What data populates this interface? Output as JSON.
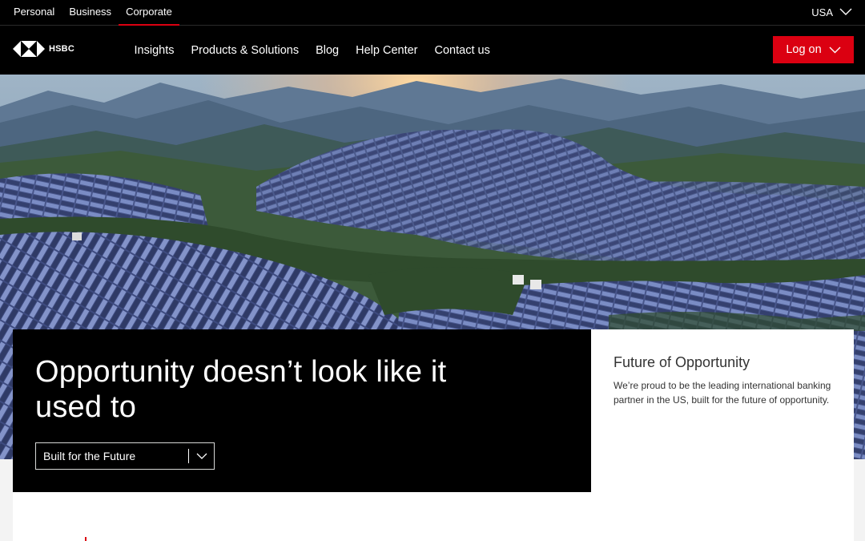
{
  "top_bar": {
    "segments": [
      "Personal",
      "Business",
      "Corporate"
    ],
    "active_segment": "Corporate",
    "country": "USA"
  },
  "nav": {
    "brand": "HSBC",
    "links": [
      "Insights",
      "Products & Solutions",
      "Blog",
      "Help Center",
      "Contact us"
    ],
    "logon_label": "Log on"
  },
  "hero": {
    "image": "aerial-solar-panel-hillsides-at-sunrise",
    "headline": "Opportunity doesn’t look like it used to",
    "dropdown_label": "Built for the Future"
  },
  "info_card": {
    "title": "Future of Opportunity",
    "text": "We’re proud to be the leading international banking partner in the US, built for the future of opportunity."
  },
  "colors": {
    "brand_red": "#db0011",
    "nav_background": "#000000",
    "card_background": "#ffffff"
  }
}
